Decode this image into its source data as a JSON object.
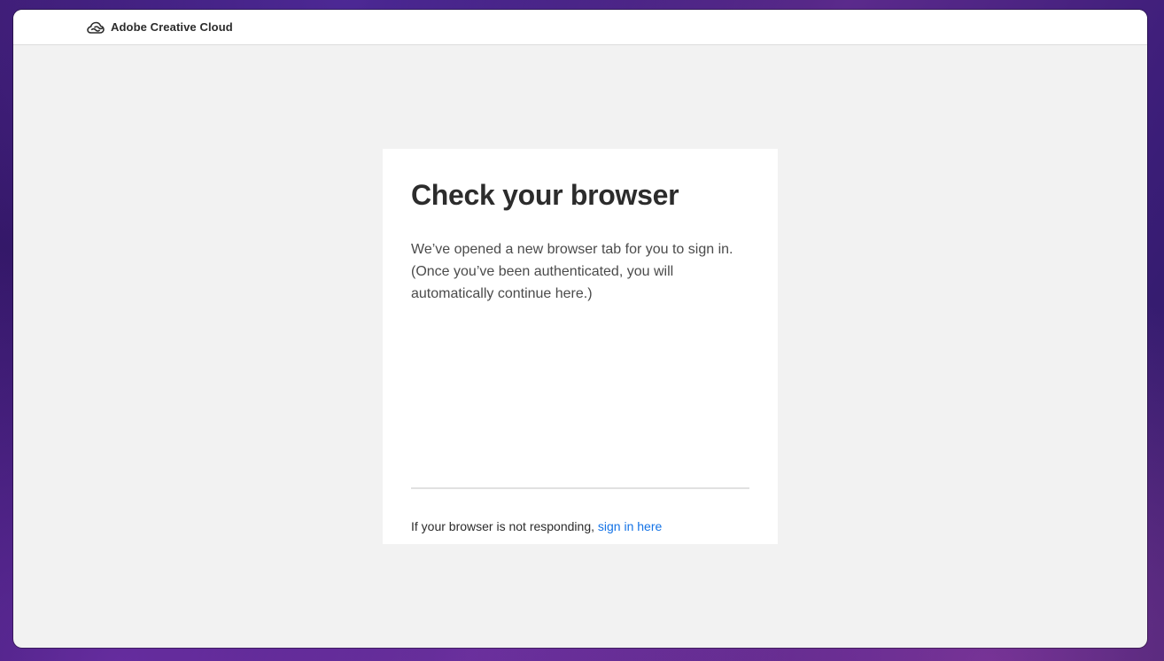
{
  "app": {
    "brand_name": "Adobe Creative Cloud",
    "brand_icon": "creative-cloud-logo-icon"
  },
  "card": {
    "title": "Check your browser",
    "message": "We’ve opened a new browser tab for you to sign in. (Once you’ve been authenticated, you will automatically continue here.)",
    "footer_text": "If your browser is not responding, ",
    "footer_link": "sign in here"
  },
  "colors": {
    "link": "#1473e6",
    "heading": "#2c2c2c",
    "body_text": "#4b4b4b",
    "window_background": "#f2f2f2",
    "card_background": "#ffffff"
  }
}
